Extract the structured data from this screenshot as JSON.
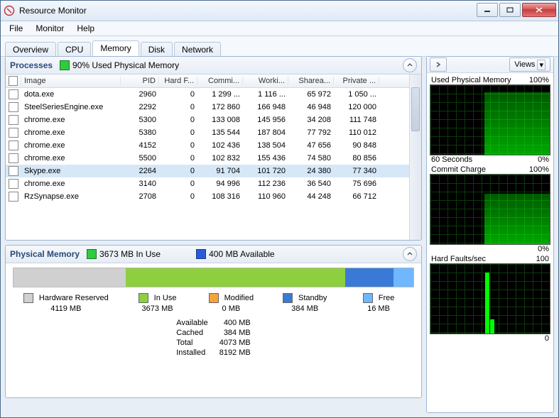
{
  "window": {
    "title": "Resource Monitor"
  },
  "menus": {
    "file": "File",
    "monitor": "Monitor",
    "help": "Help"
  },
  "tabs": {
    "overview": "Overview",
    "cpu": "CPU",
    "memory": "Memory",
    "disk": "Disk",
    "network": "Network"
  },
  "processes": {
    "title": "Processes",
    "used_pct_label": "90% Used Physical Memory",
    "columns": {
      "image": "Image",
      "pid": "PID",
      "hard": "Hard F...",
      "commit": "Commi...",
      "working": "Worki...",
      "share": "Sharea...",
      "private": "Private ..."
    },
    "rows": [
      {
        "image": "dota.exe",
        "pid": "2960",
        "hard": "0",
        "commit": "1 299 ...",
        "working": "1 116 ...",
        "share": "65 972",
        "private": "1 050 ..."
      },
      {
        "image": "SteelSeriesEngine.exe",
        "pid": "2292",
        "hard": "0",
        "commit": "172 860",
        "working": "166 948",
        "share": "46 948",
        "private": "120 000"
      },
      {
        "image": "chrome.exe",
        "pid": "5300",
        "hard": "0",
        "commit": "133 008",
        "working": "145 956",
        "share": "34 208",
        "private": "111 748"
      },
      {
        "image": "chrome.exe",
        "pid": "5380",
        "hard": "0",
        "commit": "135 544",
        "working": "187 804",
        "share": "77 792",
        "private": "110 012"
      },
      {
        "image": "chrome.exe",
        "pid": "4152",
        "hard": "0",
        "commit": "102 436",
        "working": "138 504",
        "share": "47 656",
        "private": "90 848"
      },
      {
        "image": "chrome.exe",
        "pid": "5500",
        "hard": "0",
        "commit": "102 832",
        "working": "155 436",
        "share": "74 580",
        "private": "80 856"
      },
      {
        "image": "Skype.exe",
        "pid": "2264",
        "hard": "0",
        "commit": "91 704",
        "working": "101 720",
        "share": "24 380",
        "private": "77 340",
        "selected": true
      },
      {
        "image": "chrome.exe",
        "pid": "3140",
        "hard": "0",
        "commit": "94 996",
        "working": "112 236",
        "share": "36 540",
        "private": "75 696"
      },
      {
        "image": "RzSynapse.exe",
        "pid": "2708",
        "hard": "0",
        "commit": "108 316",
        "working": "110 960",
        "share": "44 248",
        "private": "66 712"
      }
    ]
  },
  "physical": {
    "title": "Physical Memory",
    "in_use_label": "3673 MB In Use",
    "available_label": "400 MB Available",
    "bars": {
      "hardware_pct": 28,
      "inuse_pct": 55,
      "modified_pct": 0,
      "standby_pct": 12,
      "free_pct": 5
    },
    "legend": {
      "hardware": {
        "name": "Hardware Reserved",
        "value": "4119 MB",
        "color": "#d0d0d0"
      },
      "inuse": {
        "name": "In Use",
        "value": "3673 MB",
        "color": "#8ecf3f"
      },
      "modified": {
        "name": "Modified",
        "value": "0 MB",
        "color": "#f5a33a"
      },
      "standby": {
        "name": "Standby",
        "value": "384 MB",
        "color": "#3a7ad6"
      },
      "free": {
        "name": "Free",
        "value": "16 MB",
        "color": "#6fb7ff"
      }
    },
    "stats": {
      "available_k": "Available",
      "available_v": "400 MB",
      "cached_k": "Cached",
      "cached_v": "384 MB",
      "total_k": "Total",
      "total_v": "4073 MB",
      "installed_k": "Installed",
      "installed_v": "8192 MB"
    }
  },
  "right": {
    "views": "Views",
    "graphs": {
      "g1": {
        "top_left": "Used Physical Memory",
        "top_right": "100%",
        "bot_left": "60 Seconds",
        "bot_right": "0%",
        "fill_pct": 90
      },
      "g2": {
        "top_left": "Commit Charge",
        "top_right": "100%",
        "bot_left": "",
        "bot_right": "0%",
        "fill_pct": 72
      },
      "g3": {
        "top_left": "Hard Faults/sec",
        "top_right": "100",
        "bot_left": "",
        "bot_right": "0",
        "fill_pct": 0
      }
    }
  },
  "colors": {
    "green_indicator": "#2ecc40",
    "blue_indicator": "#2a5ad6"
  }
}
